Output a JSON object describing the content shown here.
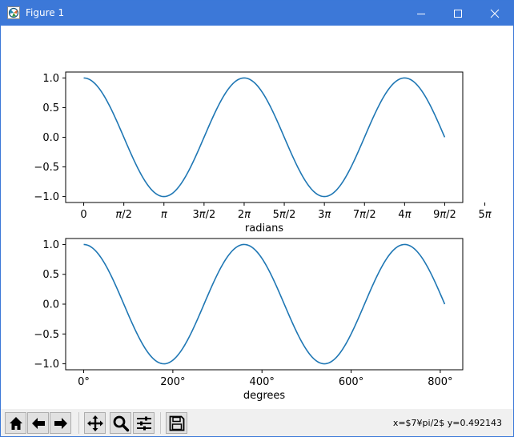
{
  "window": {
    "title": "Figure 1",
    "title_color": "#ffffff",
    "titlebar_color": "#3c78d8"
  },
  "toolbar": {
    "buttons": [
      {
        "icon": "home-icon"
      },
      {
        "icon": "back-arrow-icon"
      },
      {
        "icon": "forward-arrow-icon"
      },
      {
        "icon": "pan-move-icon"
      },
      {
        "icon": "zoom-magnifier-icon"
      },
      {
        "icon": "configure-subplots-icon"
      },
      {
        "icon": "save-floppy-icon"
      }
    ],
    "status": "x=$7¥pi/2$ y=0.492143"
  },
  "chart_data": [
    {
      "type": "line",
      "function": "cos(x)",
      "x_range": [
        0,
        14.137
      ],
      "xlim": [
        -0.707,
        14.844
      ],
      "ylim": [
        -1.1,
        1.1
      ],
      "xlabel": "radians",
      "ylabel": "",
      "x_ticks": [
        0,
        1.5708,
        3.1416,
        4.7124,
        6.2832,
        7.854,
        9.4248,
        10.9956,
        12.5664,
        14.1372,
        15.708
      ],
      "x_tick_labels": [
        "0",
        "π/2",
        "π",
        "3π/2",
        "2π",
        "5π/2",
        "3π",
        "7π/2",
        "4π",
        "9π/2",
        "5π"
      ],
      "y_ticks": [
        1.0,
        0.5,
        0.0,
        -0.5,
        -1.0
      ],
      "y_tick_labels": [
        "1.0",
        "0.5",
        "0.0",
        "−0.5",
        "−1.0"
      ],
      "line_color": "#1f77b4",
      "grid": false
    },
    {
      "type": "line",
      "function": "cos(x)",
      "x_range": [
        0,
        810
      ],
      "xlim": [
        -40.5,
        850.5
      ],
      "ylim": [
        -1.1,
        1.1
      ],
      "xlabel": "degrees",
      "ylabel": "",
      "x_ticks": [
        0,
        200,
        400,
        600,
        800
      ],
      "x_tick_labels": [
        "0°",
        "200°",
        "400°",
        "600°",
        "800°"
      ],
      "y_ticks": [
        1.0,
        0.5,
        0.0,
        -0.5,
        -1.0
      ],
      "y_tick_labels": [
        "1.0",
        "0.5",
        "0.0",
        "−0.5",
        "−1.0"
      ],
      "line_color": "#1f77b4",
      "grid": false
    }
  ]
}
